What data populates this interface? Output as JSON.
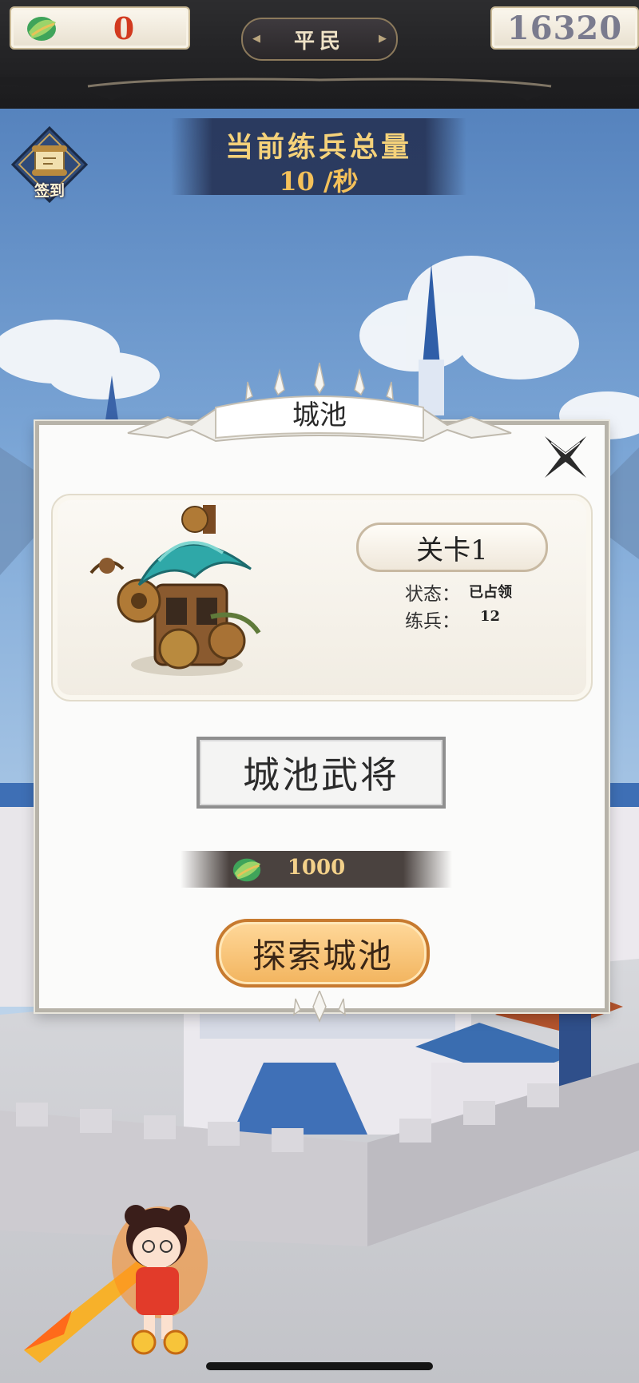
{
  "header": {
    "jade_count": "0",
    "rank_label": "平民",
    "coins": "16320"
  },
  "checkin": {
    "label": "签到"
  },
  "banner": {
    "title": "当前练兵总量",
    "rate": "10 /秒"
  },
  "dialog": {
    "title": "城池",
    "level_label": "关卡1",
    "status_label": "状态：",
    "status_value": "已占领",
    "troops_label": "练兵：",
    "troops_value": "12",
    "general_button": "城池武将",
    "cost": "1000",
    "explore_button": "探索城池"
  },
  "icons": {
    "currency": "jade-leaf-icon",
    "checkin": "scroll-checkin-icon",
    "close": "close-x-icon"
  },
  "colors": {
    "accent_gold": "#f5c15a",
    "red_value": "#d23a1f",
    "button_orange": "#f2b45e"
  }
}
